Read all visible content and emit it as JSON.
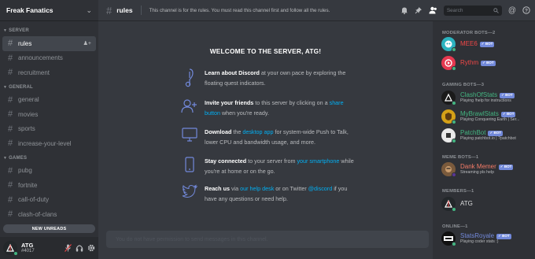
{
  "server": {
    "name": "Freak Fanatics"
  },
  "categories": {
    "server": "SERVER",
    "general": "GENERAL",
    "games": "GAMES"
  },
  "channels": {
    "rules": "rules",
    "announcements": "announcements",
    "recruitment": "recruitment",
    "general": "general",
    "movies": "movies",
    "sports": "sports",
    "increase_your_level": "increase-your-level",
    "pubg": "pubg",
    "fortnite": "fortnite",
    "call_of_duty": "call-of-duty",
    "clash_of_clans": "clash-of-clans"
  },
  "new_unreads": "NEW UNREADS",
  "user": {
    "name": "ATG",
    "tag": "#4017"
  },
  "header": {
    "channel": "rules",
    "topic": "This channel is for the rules. You must read this channel first and follow all the rules.",
    "search_placeholder": "Search"
  },
  "welcome": {
    "title": "WELCOME TO THE SERVER, ATG!",
    "f1_bold": "Learn about Discord",
    "f1_text": " at your own pace by exploring the floating quest indicators.",
    "f2_bold": "Invite your friends",
    "f2_text": " to this server by clicking on a ",
    "f2_link": "share button",
    "f2_text2": " when you're ready.",
    "f3_bold": "Download",
    "f3_text": " the ",
    "f3_link": "desktop app",
    "f3_text2": " for system-wide Push to Talk, lower CPU and bandwidth usage, and more.",
    "f4_bold": "Stay connected",
    "f4_text": " to your server from ",
    "f4_link": "your smartphone",
    "f4_text2": " while you're at home or on the go.",
    "f5_bold": "Reach us",
    "f5_text": " via ",
    "f5_link": "our help desk",
    "f5_text2": " or on Twitter ",
    "f5_link2": "@discord",
    "f5_text3": " if you have any questions or need help."
  },
  "composer_placeholder": "You do not have permission to send messages in this channel.",
  "member_groups": {
    "moderator_bots": "MODERATOR BOTS—2",
    "gaming_bots": "GAMING BOTS—3",
    "meme_bots": "MEME BOTS—1",
    "members": "MEMBERS—1",
    "online": "ONLINE—1"
  },
  "bot_tag": "BOT",
  "members": {
    "mee6": {
      "name": "MEE6",
      "color": "#f04747"
    },
    "rythm": {
      "name": "Rythm",
      "color": "#f04747"
    },
    "clashofstats": {
      "name": "ClashOfStats",
      "status": "Playing !help for instructions",
      "color": "#43b581"
    },
    "mybrawlstats": {
      "name": "MyBrawlStats",
      "status": "Playing Conquering Earth | Ser...",
      "color": "#43b581"
    },
    "patchbot": {
      "name": "PatchBot",
      "status": "Playing patchbot.io | ?patchbot",
      "color": "#43b581"
    },
    "dankmemer": {
      "name": "Dank Memer",
      "status": "Streaming pls help",
      "color": "#f47b67"
    },
    "atg": {
      "name": "ATG",
      "color": "#dcddde"
    },
    "statsroyale": {
      "name": "StatsRoyale",
      "status": "Playing coder stats :)",
      "color": "#7289da"
    }
  },
  "status_colors": {
    "online": "#43b581",
    "streaming": "#593695"
  },
  "accent": "#7289da",
  "link_color": "#00b0f4"
}
